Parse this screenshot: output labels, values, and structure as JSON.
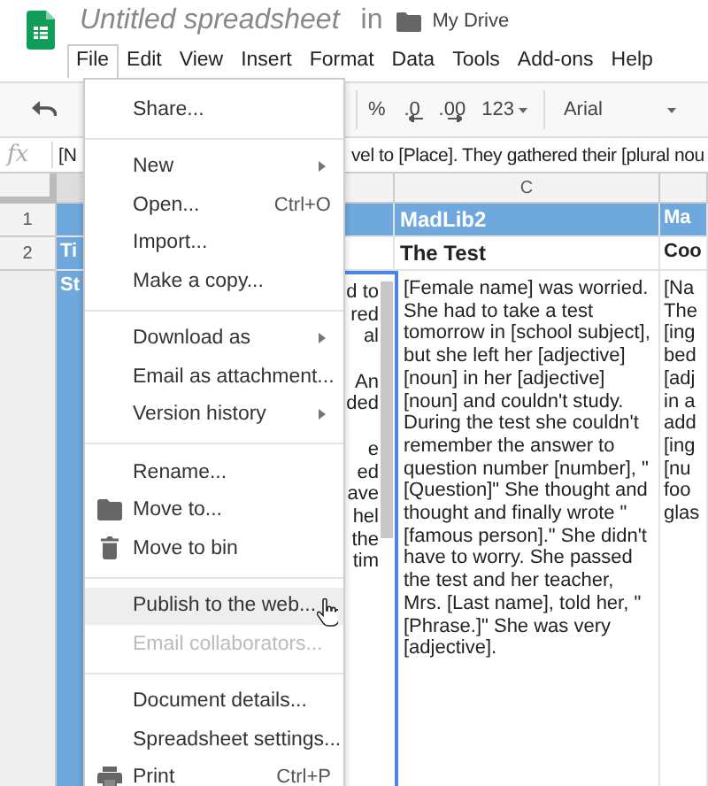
{
  "doc": {
    "title": "Untitled spreadsheet",
    "location_prefix": "in",
    "folder": "My Drive"
  },
  "menubar": [
    {
      "label": "File",
      "selected": true
    },
    {
      "label": "Edit",
      "selected": false
    },
    {
      "label": "View",
      "selected": false
    },
    {
      "label": "Insert",
      "selected": false
    },
    {
      "label": "Format",
      "selected": false
    },
    {
      "label": "Data",
      "selected": false
    },
    {
      "label": "Tools",
      "selected": false
    },
    {
      "label": "Add-ons",
      "selected": false
    },
    {
      "label": "Help",
      "selected": false
    }
  ],
  "toolbar": {
    "percent": "%",
    "decrease_decimals": ".0",
    "increase_decimals": ".00",
    "number_format": "123",
    "font": "Arial"
  },
  "formula_bar": {
    "label": "fx",
    "fragments": [
      "[N",
      "vel to [Place]. They gathered their [plural nou"
    ]
  },
  "sheet": {
    "row_numbers": [
      "1",
      "2"
    ],
    "column_header": "C",
    "column_a": [
      "Ti",
      "St"
    ],
    "column_b": [
      [
        "d to",
        "red",
        "al"
      ],
      [
        "An",
        "ded"
      ],
      [
        "e",
        "ed",
        "ave",
        "hel",
        "the",
        "tim"
      ]
    ],
    "column_c": {
      "header": "MadLib2",
      "title": "The Test",
      "story": "[Female name] was worried. She had to take a test tomorrow in [school subject], but she left her [adjective] [noun] in her [adjective] [noun] and couldn't study. During the test she couldn't remember the answer to question number [number], \"[Question]\" She thought and thought and finally wrote \"[famous person].\" She didn't have to worry. She passed the test and her teacher, Mrs. [Last name], told her, \"[Phrase.]\" She was very [adjective]."
    },
    "column_d": {
      "header": "Ma",
      "title": "Coo",
      "lines": [
        "[Na",
        "The",
        "[ing",
        "bed",
        "[adj",
        "in a",
        "add",
        "[ing",
        "[nu",
        "foo",
        "glas"
      ]
    }
  },
  "file_menu": [
    {
      "kind": "item",
      "label": "Share...",
      "disabled": false,
      "hovered": false
    },
    {
      "kind": "divider"
    },
    {
      "kind": "item",
      "label": "New",
      "submenu": true,
      "disabled": false,
      "hovered": false
    },
    {
      "kind": "item",
      "label": "Open...",
      "shortcut": "Ctrl+O",
      "disabled": false,
      "hovered": false
    },
    {
      "kind": "item",
      "label": "Import...",
      "disabled": false,
      "hovered": false
    },
    {
      "kind": "item",
      "label": "Make a copy...",
      "disabled": false,
      "hovered": false
    },
    {
      "kind": "divider"
    },
    {
      "kind": "item",
      "label": "Download as",
      "submenu": true,
      "disabled": false,
      "hovered": false
    },
    {
      "kind": "item",
      "label": "Email as attachment...",
      "disabled": false,
      "hovered": false
    },
    {
      "kind": "item",
      "label": "Version history",
      "submenu": true,
      "disabled": false,
      "hovered": false
    },
    {
      "kind": "divider"
    },
    {
      "kind": "item",
      "label": "Rename...",
      "disabled": false,
      "hovered": false
    },
    {
      "kind": "folder",
      "label": "Move to...",
      "disabled": false,
      "hovered": false
    },
    {
      "kind": "trash",
      "label": "Move to bin",
      "disabled": false,
      "hovered": false
    },
    {
      "kind": "divider"
    },
    {
      "kind": "item",
      "label": "Publish to the web...",
      "disabled": false,
      "hovered": true
    },
    {
      "kind": "item",
      "label": "Email collaborators...",
      "disabled": true,
      "hovered": false
    },
    {
      "kind": "divider"
    },
    {
      "kind": "item",
      "label": "Document details...",
      "disabled": false,
      "hovered": false
    },
    {
      "kind": "item",
      "label": "Spreadsheet settings...",
      "disabled": false,
      "hovered": false
    },
    {
      "kind": "printer",
      "label": "Print",
      "shortcut": "Ctrl+P",
      "disabled": false,
      "hovered": false
    }
  ]
}
